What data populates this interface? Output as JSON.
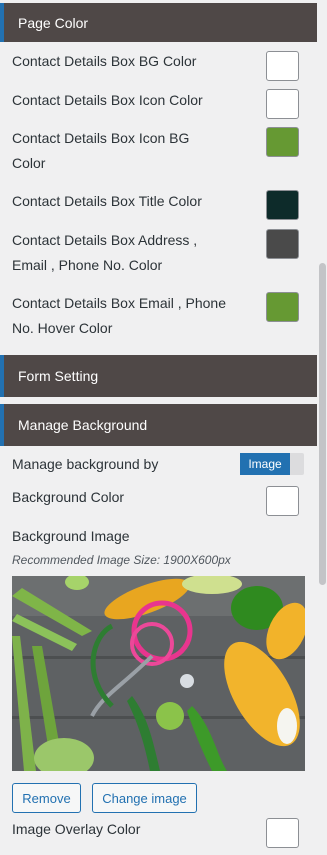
{
  "sections": {
    "page_color": "Page Color",
    "form_setting": "Form Setting",
    "manage_background": "Manage Background"
  },
  "colors": {
    "bg_color": "#ffffff",
    "icon_color": "#ffffff",
    "icon_bg_color": "#669933",
    "title_color": "#0d2b2a",
    "address_color": "#4a4a4a",
    "hover_color": "#669933",
    "background_color": "#ffffff",
    "overlay_color": "#ffffff"
  },
  "labels": {
    "bg_color": "Contact Details Box BG Color",
    "icon_color": "Contact Details Box Icon Color",
    "icon_bg_line1": "Contact Details Box Icon BG",
    "icon_bg_line2": "Color",
    "title_color": "Contact Details Box Title Color",
    "address_line1": "Contact Details Box Address ,",
    "address_line2": "Email , Phone No. Color",
    "hover_line1": "Contact Details Box Email , Phone",
    "hover_line2": "No. Hover Color",
    "manage_by": "Manage background by",
    "background_color": "Background Color",
    "background_image": "Background Image",
    "recommended": "Recommended Image Size: 1900X600px",
    "overlay_color": "Image Overlay Color"
  },
  "toggle": {
    "label": "Image"
  },
  "buttons": {
    "remove": "Remove",
    "change": "Change image"
  }
}
